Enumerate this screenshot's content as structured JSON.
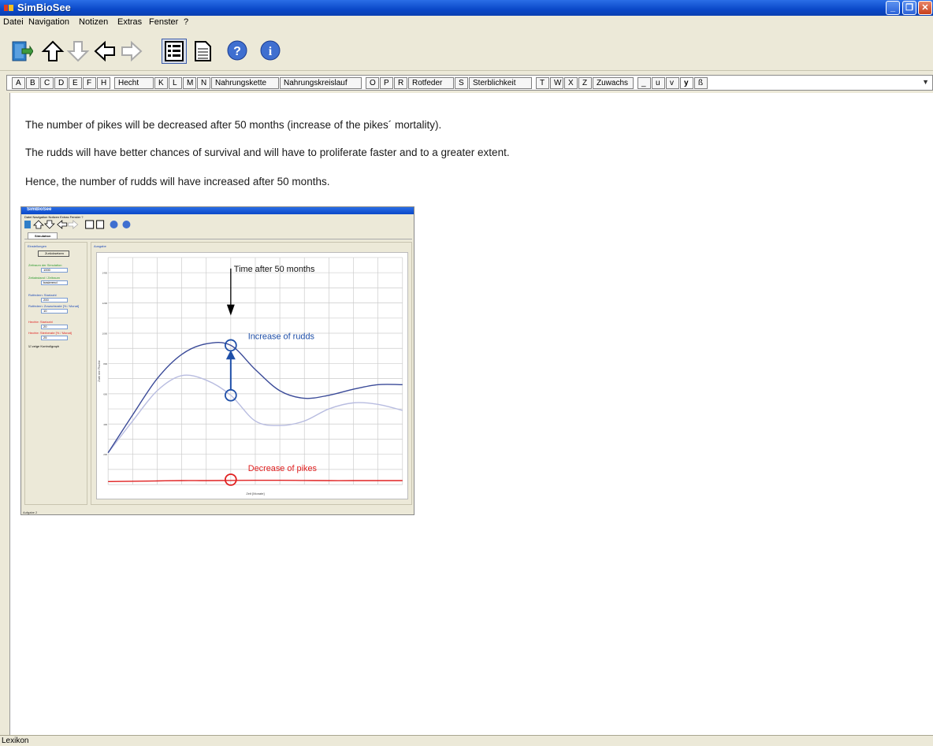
{
  "window": {
    "title": "SimBioSee"
  },
  "menu": [
    "Datei",
    "Navigation",
    "Notizen",
    "Extras",
    "Fenster",
    "?"
  ],
  "toolbar": {
    "buttons": [
      {
        "icon": "exit-door-icon"
      },
      {
        "icon": "arrow-up-icon"
      },
      {
        "icon": "arrow-down-icon"
      },
      {
        "icon": "arrow-left-icon"
      },
      {
        "icon": "arrow-right-icon"
      },
      {
        "icon": "list-view-icon",
        "selected": true
      },
      {
        "icon": "document-icon"
      },
      {
        "icon": "help-icon"
      },
      {
        "icon": "info-icon"
      }
    ]
  },
  "tabs": [
    "A",
    "B",
    "C",
    "D",
    "E",
    "F",
    "H",
    "Hecht",
    "K",
    "L",
    "M",
    "N",
    "Nahrungskette",
    "Nahrungskreislauf",
    "O",
    "P",
    "R",
    "Rotfeder",
    "S",
    "Sterblichkeit",
    "T",
    "W",
    "X",
    "Z",
    "Zuwachs",
    "_",
    "u",
    "v",
    "y",
    "ß"
  ],
  "active_tab": "y",
  "content": {
    "para1": "The number of pikes will be decreased after 50 months (increase of the pikes´ mortality).",
    "para2": "The rudds will have better chances of survival and will have to proliferate faster and to a greater extent.",
    "para3": "Hence, the number of rudds will have increased after 50 months."
  },
  "embedded": {
    "title": "SimBioSee",
    "menu": "Datei  Navigation  Notizen  Extras  Fenster  ?",
    "tab": "Simulation",
    "left_header": "Einstellungen",
    "left_button": "Zurücksetzen",
    "fields": [
      {
        "label": "Zeitraum der Simulation",
        "value": "1000",
        "color": "#2e9a2e"
      },
      {
        "label": "Zeitabstand / Zeitraum",
        "value": "basierend",
        "color": "#2e9a2e"
      },
      {
        "label": "Rotfedern: Startzahl",
        "value": "200",
        "color": "#1e4bb8"
      },
      {
        "label": "Rotfedern: Zuwachsrate [% / Monat]",
        "value": "10",
        "color": "#1e4bb8"
      },
      {
        "label": "Hechte: Startzahl",
        "value": "20",
        "color": "#e02020"
      },
      {
        "label": "Hechte: Sterberate [% / Monat]",
        "value": "25",
        "color": "#e02020"
      }
    ],
    "checkbox_label": "zeige Kontrollgraph",
    "right_header": "Ausgabe",
    "status": "Aufgabe 2"
  },
  "annotations": {
    "time_label": "Time after 50 months",
    "rudds_label": "Increase of rudds",
    "pikes_label": "Decrease of pikes"
  },
  "chart_data": {
    "type": "line",
    "title": "",
    "xlabel": "Zeit [Monate]",
    "ylabel": "Zahl der Fische",
    "x": [
      0,
      10,
      20,
      30,
      40,
      50,
      60,
      70,
      80,
      90,
      100,
      110,
      120
    ],
    "xlim": [
      0,
      120
    ],
    "ylim": [
      0,
      1500
    ],
    "series": [
      {
        "values": [
          210,
          460,
          700,
          860,
          930,
          920,
          760,
          620,
          570,
          590,
          630,
          660,
          660
        ],
        "color": "#3a4a98"
      },
      {
        "values": [
          210,
          420,
          620,
          720,
          690,
          590,
          420,
          390,
          420,
          500,
          540,
          530,
          490
        ],
        "color": "#b8bce0"
      },
      {
        "values": [
          20,
          22,
          24,
          26,
          26,
          27,
          28,
          28,
          27,
          26,
          26,
          26,
          26
        ],
        "color": "#e02020"
      }
    ],
    "colors": {
      "rudds": "#1f4fa8",
      "pikes": "#e02020"
    }
  }
}
